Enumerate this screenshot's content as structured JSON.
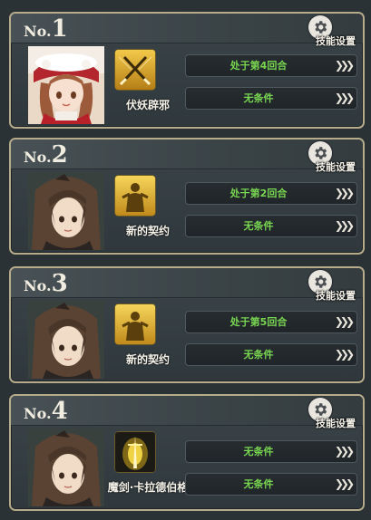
{
  "skill_settings_label": "技能设置",
  "panels": [
    {
      "no_prefix": "No.",
      "number": "1",
      "skill_name": "伏妖辟邪",
      "conditions": [
        "处于第4回合",
        "无条件"
      ]
    },
    {
      "no_prefix": "No.",
      "number": "2",
      "skill_name": "新的契约",
      "conditions": [
        "处于第2回合",
        "无条件"
      ]
    },
    {
      "no_prefix": "No.",
      "number": "3",
      "skill_name": "新的契约",
      "conditions": [
        "处于第5回合",
        "无条件"
      ]
    },
    {
      "no_prefix": "No.",
      "number": "4",
      "skill_name": "魔剑·卡拉德伯格",
      "conditions": [
        "无条件",
        "无条件"
      ]
    }
  ],
  "arrow_glyph": "❯❯❯",
  "colors": {
    "condition_text": "#79d651",
    "panel_border": "#b6ab8a"
  }
}
